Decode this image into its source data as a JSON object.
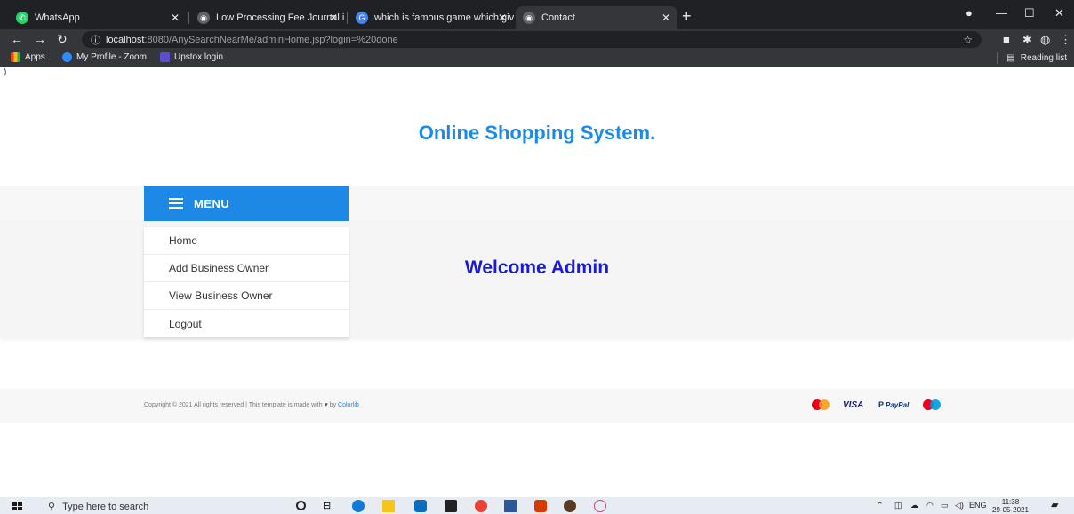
{
  "browser": {
    "tabs": [
      {
        "label": "WhatsApp"
      },
      {
        "label": "Low Processing Fee Journal in En"
      },
      {
        "label": "which is famous game which give"
      },
      {
        "label": "Contact"
      }
    ],
    "url_host": "localhost",
    "url_path": ":8080/AnySearchNearMe/adminHome.jsp?login=%20done",
    "bookmarks": [
      {
        "label": "Apps"
      },
      {
        "label": "My Profile - Zoom"
      },
      {
        "label": "Upstox login"
      }
    ],
    "reading_list": "Reading list"
  },
  "page": {
    "stray_text": ")",
    "site_title": "Online Shopping System.",
    "menu_title": "MENU",
    "menu_items": [
      {
        "label": "Home"
      },
      {
        "label": "Add Business Owner"
      },
      {
        "label": "View Business Owner"
      },
      {
        "label": "Logout"
      }
    ],
    "welcome": "Welcome Admin",
    "footer": {
      "copyright": "Copyright © 2021 All rights reserved | This template is made with",
      "by": "by",
      "link": "Colorlib",
      "payments": [
        "VISA",
        "PayPal"
      ]
    }
  },
  "taskbar": {
    "search_placeholder": "Type here to search",
    "lang": "ENG",
    "time": "11:38",
    "date": "29-05-2021"
  },
  "colors": {
    "accent": "#1e88e5",
    "welcome": "#1a1adc"
  }
}
